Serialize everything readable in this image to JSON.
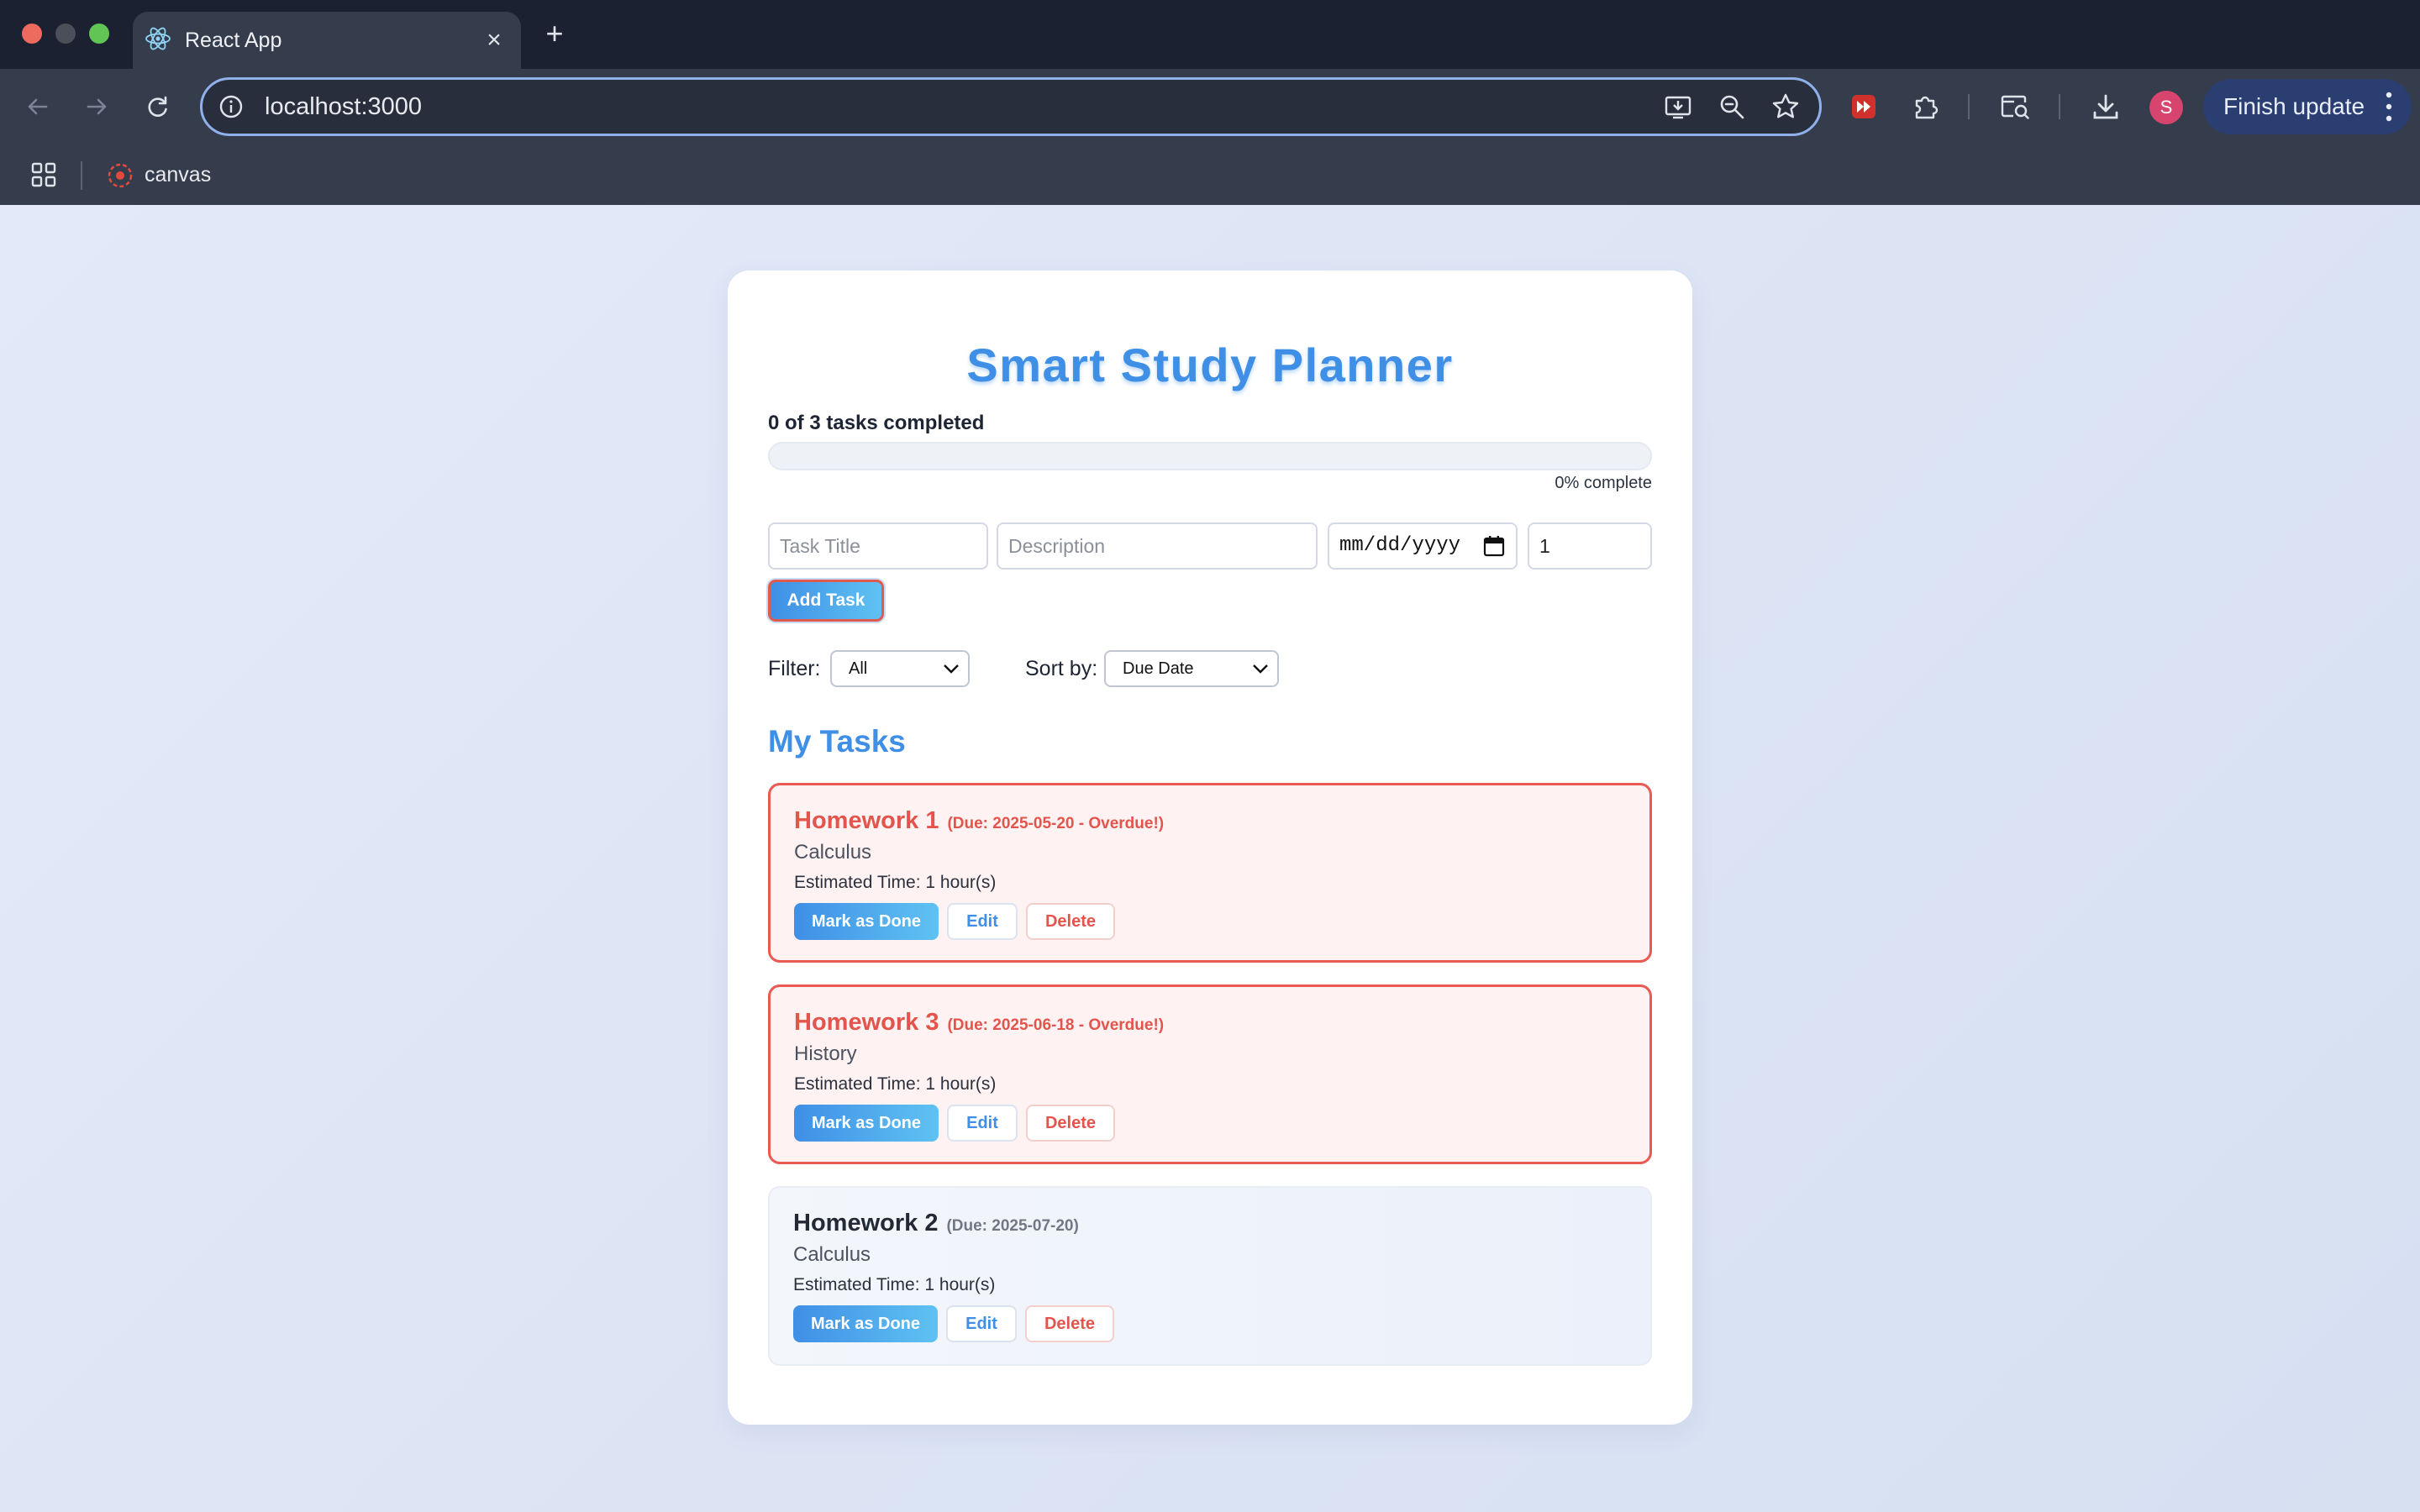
{
  "browser": {
    "tab_title": "React App",
    "url": "localhost:3000",
    "bookmark_canvas": "canvas",
    "profile_initial": "S",
    "finish_update_label": "Finish update"
  },
  "app": {
    "title": "Smart Study Planner",
    "progress_label": "0 of 3 tasks completed",
    "progress_fraction": 0,
    "progress_pct_label": "0% complete",
    "form": {
      "title_placeholder": "Task Title",
      "desc_placeholder": "Description",
      "date_placeholder": "mm/dd/yyyy",
      "hours_value": "1",
      "add_button": "Add Task"
    },
    "filter_label": "Filter:",
    "filter_value": "All",
    "sort_label": "Sort by:",
    "sort_value": "Due Date",
    "tasks_heading": "My Tasks",
    "tasks": [
      {
        "title": "Homework 1",
        "due": "(Due: 2025-05-20 - Overdue!)",
        "description": "Calculus",
        "estimate": "Estimated Time: 1 hour(s)",
        "done_label": "Mark as Done",
        "edit_label": "Edit",
        "delete_label": "Delete",
        "status_color": "#e3554c"
      },
      {
        "title": "Homework 3",
        "due": "(Due: 2025-06-18 - Overdue!)",
        "description": "History",
        "estimate": "Estimated Time: 1 hour(s)",
        "done_label": "Mark as Done",
        "edit_label": "Edit",
        "delete_label": "Delete",
        "status_color": "#e3554c"
      },
      {
        "title": "Homework 2",
        "due": "(Due: 2025-07-20)",
        "description": "Calculus",
        "estimate": "Estimated Time: 1 hour(s)",
        "done_label": "Mark as Done",
        "edit_label": "Edit",
        "delete_label": "Delete",
        "status_color": "#232a36"
      }
    ]
  },
  "colors": {
    "accent": "#3f8fe6",
    "overdue": "#e3554c",
    "page_bg": "#dde5f4"
  }
}
